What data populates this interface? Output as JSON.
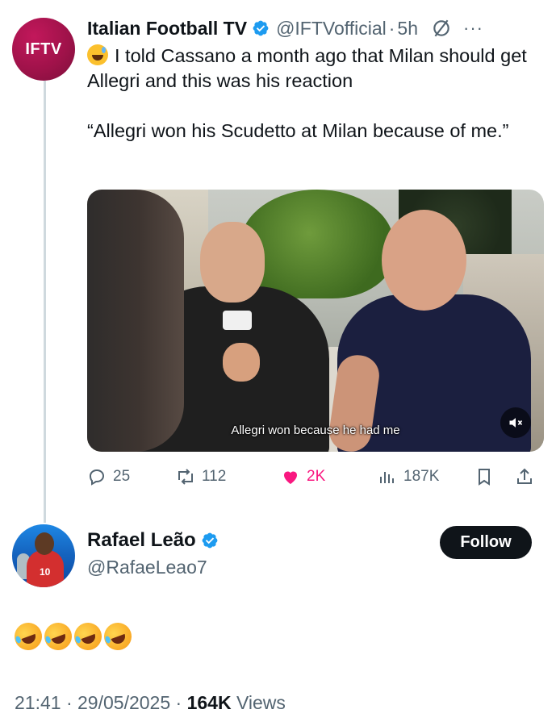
{
  "tweet": {
    "author_name": "Italian Football TV",
    "author_handle": "@IFTVofficial",
    "avatar_text": "IFTV",
    "time": "5h",
    "separator": "·",
    "text_line1": "I told Cassano a month ago that Milan should get Allegri and this was his reaction",
    "text_line2": "“Allegri won his Scudetto at Milan because of me.”",
    "video_caption": "Allegri won because he had me",
    "stats": {
      "replies": "25",
      "reposts": "112",
      "likes": "2K",
      "views": "187K"
    }
  },
  "reply": {
    "author_name": "Rafael Leão",
    "author_handle": "@RafaeLeao7",
    "follow_label": "Follow",
    "avatar_number": "10",
    "emoji_name": "rolling-on-the-floor-laughing",
    "emoji_count": 4,
    "time": "21:41",
    "date": "29/05/2025",
    "views_count": "164K",
    "views_label": "Views"
  },
  "colors": {
    "verified": "#1d9bf0",
    "like": "#f91880",
    "muted_text": "#536471",
    "iftv_brand": "#a0124a"
  }
}
